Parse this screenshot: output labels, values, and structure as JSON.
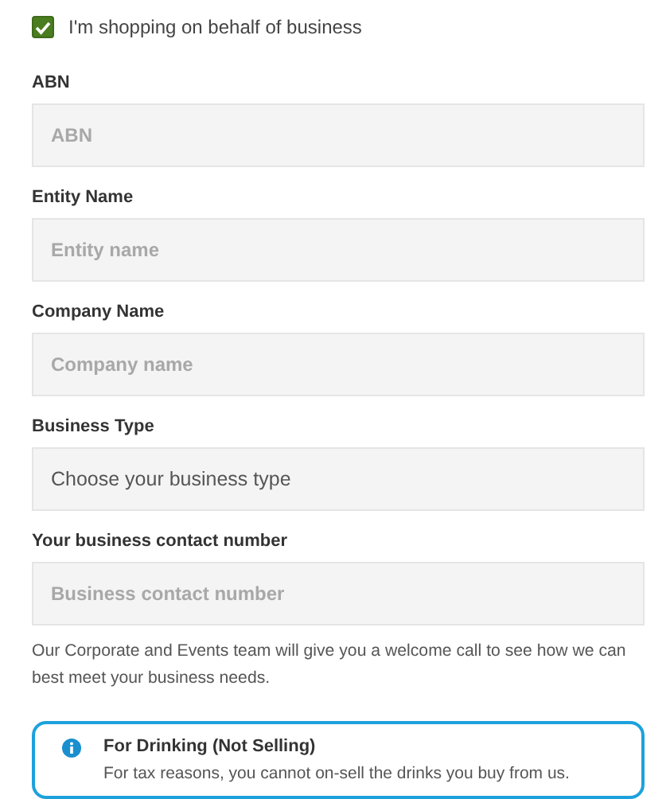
{
  "business_checkbox": {
    "label": "I'm shopping on behalf of business",
    "checked": true
  },
  "fields": [
    {
      "kind": "input",
      "label": "ABN",
      "placeholder": "ABN"
    },
    {
      "kind": "input",
      "label": "Entity Name",
      "placeholder": "Entity name"
    },
    {
      "kind": "input",
      "label": "Company Name",
      "placeholder": "Company name"
    },
    {
      "kind": "select",
      "label": "Business Type",
      "value": "Choose your business type"
    },
    {
      "kind": "input",
      "label": "Your business contact number",
      "placeholder": "Business contact number"
    }
  ],
  "help_text": "Our Corporate and Events team will give you a welcome call to see how we can best meet your business needs.",
  "notice": {
    "title": "For Drinking (Not Selling)",
    "text": "For tax reasons, you cannot on-sell the drinks you buy from us."
  }
}
